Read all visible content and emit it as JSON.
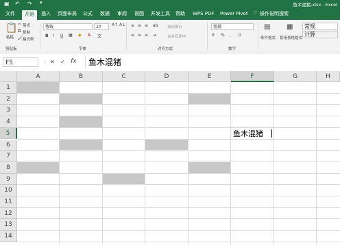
{
  "title": {
    "filename": "鱼木混猪.xlsx - Excel"
  },
  "tabs": [
    "文件",
    "开始",
    "插入",
    "页面布局",
    "公式",
    "数据",
    "审阅",
    "视图",
    "开发工具",
    "帮助",
    "WPS PDF",
    "Power Pivot"
  ],
  "tell_me": "操作说明搜索",
  "ribbon": {
    "clipboard": {
      "paste": "粘贴",
      "cut": "剪切",
      "copy": "复制",
      "format_painter": "格式刷",
      "label": "剪贴板"
    },
    "font": {
      "name": "等线",
      "size": "20",
      "bold": "B",
      "italic": "I",
      "underline": "U",
      "label": "字体"
    },
    "alignment": {
      "wrap": "自动换行",
      "merge": "合并后居中",
      "label": "对齐方式"
    },
    "number": {
      "format": "常规",
      "label": "数字"
    },
    "styles": {
      "conditional": "条件格式",
      "table": "套用表格格式",
      "normal": "常规",
      "calc": "计算"
    }
  },
  "formula_bar": {
    "name_box": "F5",
    "fx": "fx",
    "content": "鱼木混猪"
  },
  "columns": [
    "A",
    "B",
    "C",
    "D",
    "E",
    "F",
    "G",
    "H"
  ],
  "rows": [
    "1",
    "2",
    "3",
    "4",
    "5",
    "6",
    "7",
    "8",
    "9",
    "10",
    "11",
    "12",
    "13",
    "14"
  ],
  "active_cell": {
    "ref": "F5",
    "text": "鱼木混猪"
  },
  "shaded_cells": [
    "A1",
    "B2",
    "E2",
    "B4",
    "B6",
    "D6",
    "A8",
    "E8",
    "C9"
  ],
  "colors": {
    "excel_green": "#217346",
    "shade": "#c8c8c8"
  }
}
